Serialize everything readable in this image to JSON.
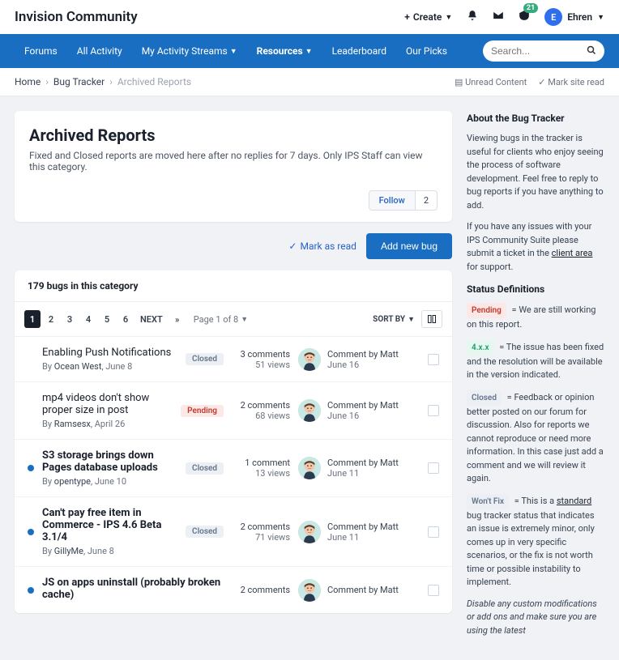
{
  "brand": "Invision Community",
  "top": {
    "create": "Create",
    "notif_count": "21",
    "user": "Ehren"
  },
  "nav": {
    "items": [
      "Forums",
      "All Activity",
      "My Activity Streams",
      "Resources",
      "Leaderboard",
      "Our Picks"
    ],
    "active_index": 3,
    "search_placeholder": "Search..."
  },
  "breadcrumbs": {
    "items": [
      "Home",
      "Bug Tracker"
    ],
    "current": "Archived Reports",
    "unread": "Unread Content",
    "marksite": "Mark site read"
  },
  "header": {
    "title": "Archived Reports",
    "desc": "Fixed and Closed reports are moved here after no replies for 7 days. Only IPS Staff can view this category.",
    "follow_label": "Follow",
    "follow_count": "2"
  },
  "actions": {
    "mark_read": "Mark as read",
    "new_bug": "Add new bug"
  },
  "list": {
    "category_count": "179 bugs in this category",
    "pages": [
      "1",
      "2",
      "3",
      "4",
      "5",
      "6"
    ],
    "next": "NEXT",
    "page_of": "Page 1 of 8",
    "sort": "SORT BY"
  },
  "rows": [
    {
      "unread": false,
      "title": "Enabling Push Notifications",
      "author": "Ocean West",
      "date": "June 8",
      "status": "Closed",
      "status_class": "s-closed",
      "comments": "3 comments",
      "views": "51 views",
      "last_by": "Comment by Matt",
      "last_date": "June 16"
    },
    {
      "unread": false,
      "title": "mp4 videos don't show proper size in post",
      "author": "Ramsesx",
      "date": "April 26",
      "status": "Pending",
      "status_class": "s-pending",
      "comments": "2 comments",
      "views": "68 views",
      "last_by": "Comment by Matt",
      "last_date": "June 16"
    },
    {
      "unread": true,
      "title": "S3 storage brings down Pages database uploads",
      "author": "opentype",
      "date": "June 10",
      "status": "Closed",
      "status_class": "s-closed",
      "comments": "1 comment",
      "views": "13 views",
      "last_by": "Comment by Matt",
      "last_date": "June 11"
    },
    {
      "unread": true,
      "title": "Can't pay free item in Commerce - IPS 4.6 Beta 3.1/4",
      "author": "GillyMe",
      "date": "June 8",
      "status": "Closed",
      "status_class": "s-closed",
      "comments": "2 comments",
      "views": "71 views",
      "last_by": "Comment by Matt",
      "last_date": "June 11"
    },
    {
      "unread": true,
      "title": "JS on apps uninstall (probably broken cache)",
      "author": "",
      "date": "",
      "status": "",
      "status_class": "",
      "comments": "2 comments",
      "views": "",
      "last_by": "Comment by Matt",
      "last_date": ""
    }
  ],
  "sidebar": {
    "about_title": "About the Bug Tracker",
    "about_p1": "Viewing bugs in the tracker is useful for clients who enjoy seeing the process of software development. Feel free to reply to bug reports if you have anything to add.",
    "about_p2a": "If you have any issues with your IPS Community Suite please submit a ticket in the ",
    "about_link": "client area",
    "about_p2b": " for support.",
    "status_title": "Status Definitions",
    "pending": "Pending",
    "pending_txt": " = We are still working on this report.",
    "ver": "4.x.x",
    "ver_txt": " = The issue has been fixed and the resolution will be available in the version indicated.",
    "closed": "Closed",
    "closed_txt": " = Feedback or opinion better posted on our forum for discussion. Also for reports we cannot reproduce or need more information. In this case just add a comment and we will review it again.",
    "wont": "Won't Fix",
    "wont_txt_a": " = This is a ",
    "wont_link": "standard",
    "wont_txt_b": " bug tracker status that indicates an issue is extremely minor, only comes up in very specific scenarios, or the fix is not worth time or possible instability to implement.",
    "note": "Disable any custom modifications or add ons and make sure you are using the latest"
  }
}
